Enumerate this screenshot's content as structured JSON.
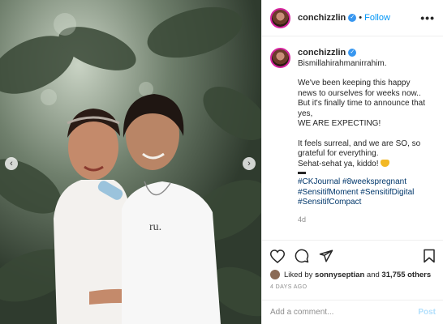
{
  "post": {
    "username": "conchizzlin",
    "follow_label": "Follow",
    "separator": "•",
    "more_label": "•••"
  },
  "caption": {
    "username": "conchizzlin",
    "lines": [
      "Bismillahirahmanirrahim.",
      "We've been keeping this happy news to ourselves for weeks now..",
      "But it's finally time to announce that yes,",
      "WE ARE EXPECTING!",
      "It feels surreal, and we are SO, so grateful for everything.",
      "Sehat-sehat ya, kiddo!"
    ],
    "hashtags_line1": "#CKJournal #8weekspregnant",
    "hashtags_line2": "#SensitifMoment #SensitifDigital",
    "hashtags_line3": "#SensitifCompact",
    "age": "4d"
  },
  "engagement": {
    "liked_by_prefix": "Liked by ",
    "liked_by_user": "sonnyseptian",
    "and_label": " and ",
    "others_count": "31,755 others",
    "date": "4 DAYS AGO"
  },
  "comment": {
    "placeholder": "Add a comment...",
    "post_label": "Post"
  },
  "icons": [
    "verified-badge-icon",
    "heart-icon",
    "comment-icon",
    "share-icon",
    "bookmark-icon",
    "chevron-left-icon",
    "chevron-right-icon",
    "heart-emoji-icon"
  ]
}
